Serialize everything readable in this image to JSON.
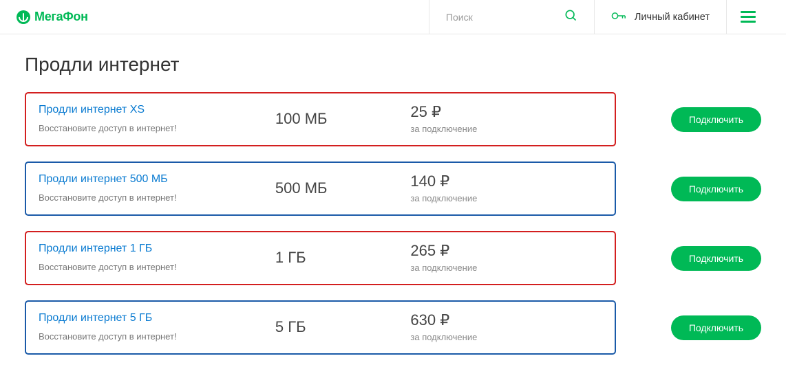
{
  "header": {
    "brand": "МегаФон",
    "search_placeholder": "Поиск",
    "cabinet_label": "Личный кабинет"
  },
  "page": {
    "title": "Продли интернет"
  },
  "plans": [
    {
      "name": "Продли интернет XS",
      "desc": "Восстановите доступ в интернет!",
      "volume": "100 МБ",
      "price": "25 ₽",
      "note": "за подключение",
      "cta": "Подключить",
      "variant": "red"
    },
    {
      "name": "Продли интернет 500 МБ",
      "desc": "Восстановите доступ в интернет!",
      "volume": "500 МБ",
      "price": "140 ₽",
      "note": "за подключение",
      "cta": "Подключить",
      "variant": "blue"
    },
    {
      "name": "Продли интернет 1 ГБ",
      "desc": "Восстановите доступ в интернет!",
      "volume": "1 ГБ",
      "price": "265 ₽",
      "note": "за подключение",
      "cta": "Подключить",
      "variant": "red"
    },
    {
      "name": "Продли интернет 5 ГБ",
      "desc": "Восстановите доступ в интернет!",
      "volume": "5 ГБ",
      "price": "630 ₽",
      "note": "за подключение",
      "cta": "Подключить",
      "variant": "blue"
    }
  ]
}
